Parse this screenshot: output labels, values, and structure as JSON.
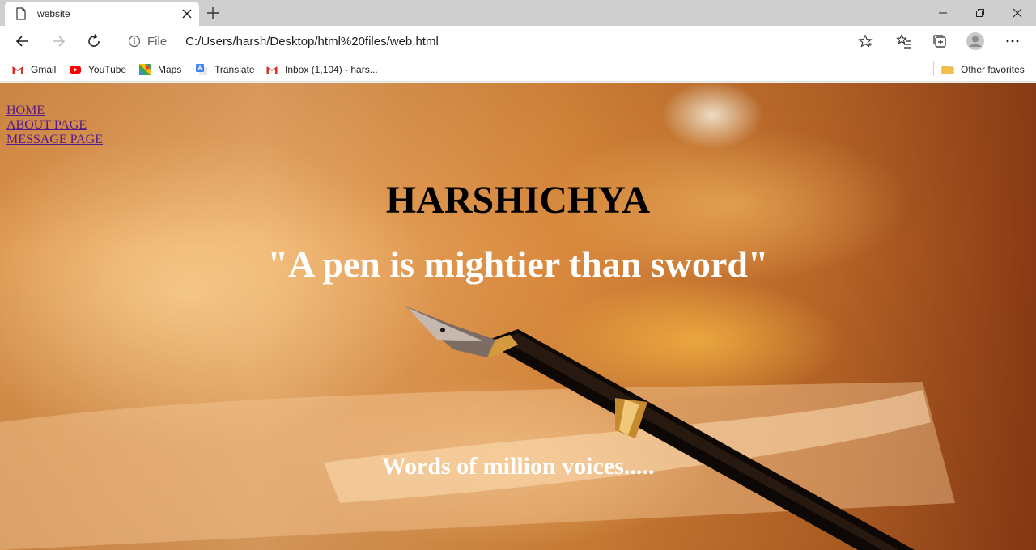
{
  "browser": {
    "tab_title": "website",
    "address_scheme": "File",
    "address_url": "C:/Users/harsh/Desktop/html%20files/web.html",
    "bookmarks": [
      {
        "label": "Gmail",
        "icon": "gmail-icon"
      },
      {
        "label": "YouTube",
        "icon": "youtube-icon"
      },
      {
        "label": "Maps",
        "icon": "maps-icon"
      },
      {
        "label": "Translate",
        "icon": "translate-icon"
      },
      {
        "label": "Inbox (1,104) - hars...",
        "icon": "gmail-icon"
      }
    ],
    "other_favorites": "Other favorites"
  },
  "page": {
    "nav": [
      "HOME",
      "ABOUT PAGE",
      "MESSAGE PAGE"
    ],
    "title": "HARSHICHYA",
    "quote": "\"A pen is mightier than sword\"",
    "tagline": "Words of million voices....."
  },
  "colors": {
    "link": "#551a8b",
    "title": "#000000",
    "quote": "#ffffff",
    "background_warm": "#d9904a"
  }
}
